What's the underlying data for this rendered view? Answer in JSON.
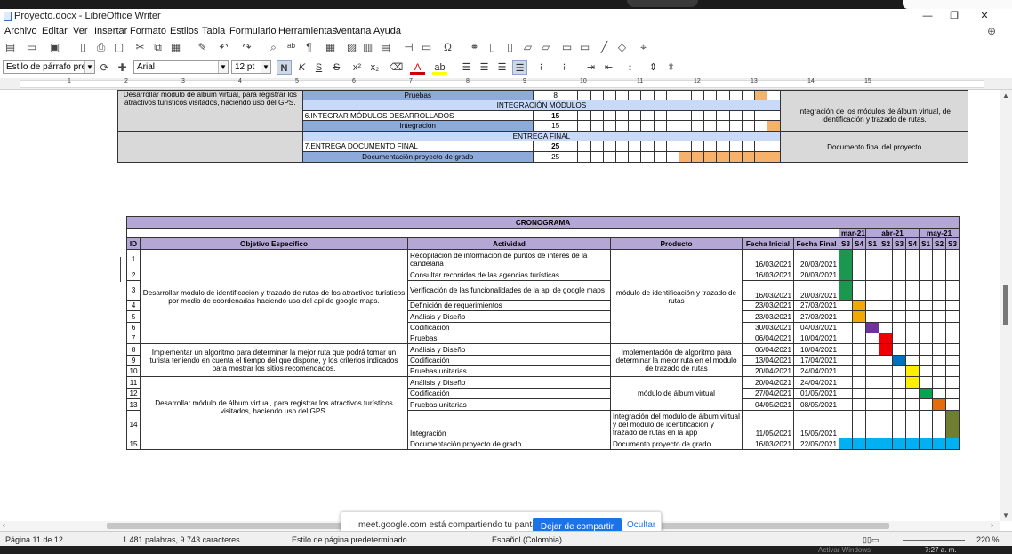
{
  "window": {
    "title": "Proyecto.docx - LibreOffice Writer"
  },
  "menu": [
    "Archivo",
    "Editar",
    "Ver",
    "Insertar",
    "Formato",
    "Estilos",
    "Tabla",
    "Formulario",
    "Herramientas",
    "Ventana",
    "Ayuda"
  ],
  "formatting": {
    "paragraph_style": "Estilo de párrafo predeterminado",
    "font_name": "Arial",
    "font_size": "12 pt",
    "bold": "N",
    "italic": "K",
    "underline": "S",
    "strike": "S",
    "superscript": "x²",
    "subscript": "x₂",
    "font_color": "A",
    "highlight": "ab"
  },
  "ruler": {
    "marks": [
      "1",
      "2",
      "3",
      "4",
      "5",
      "6",
      "7",
      "8",
      "9",
      "10",
      "11",
      "12",
      "13",
      "14",
      "15"
    ]
  },
  "upper_table": {
    "desc": "Desarrollar módulo de álbum virtual, para registrar los atractivos turísticos visitados, haciendo uso del GPS.",
    "rows": [
      {
        "label": "Pruebas",
        "num": "8",
        "kind": "task",
        "fill": "#f6b26b"
      },
      {
        "label": "INTEGRACIÓN MÓDULOS",
        "num": "",
        "kind": "section"
      },
      {
        "label": "6.INTEGRAR MÓDULOS DESARROLLADOS",
        "num": "15",
        "kind": "phase"
      },
      {
        "label": "Integración",
        "num": "15",
        "kind": "task",
        "fill": "#f6b26b"
      },
      {
        "label": "ENTREGA FINAL",
        "num": "",
        "kind": "section"
      },
      {
        "label": "7.ENTREGA DOCUMENTO FINAL",
        "num": "25",
        "kind": "phase"
      },
      {
        "label": "Documentación proyecto de grado",
        "num": "25",
        "kind": "task",
        "fill": "#f6b26b"
      }
    ],
    "product_a": "Integración de los módulos de álbum virtual, de identificación y trazado de rutas.",
    "product_b": "Documento final del proyecto"
  },
  "cronograma": {
    "title": "CRONOGRAMA",
    "months": [
      "mar-21",
      "abr-21",
      "may-21"
    ],
    "weeks": [
      "S3",
      "S4",
      "S1",
      "S2",
      "S3",
      "S4",
      "S1",
      "S2",
      "S3"
    ],
    "headers": {
      "id": "ID",
      "objective": "Objetivo Especifico",
      "activity": "Actividad",
      "product": "Producto",
      "start": "Fecha Inicial",
      "end": "Fecha Final"
    },
    "objectives": [
      "Desarrollar módulo de identificación y trazado de rutas de los atractivos turísticos por medio de coordenadas haciendo uso del api de google maps.",
      "Implementar un algoritmo para determinar la mejor ruta que podrá tomar un turista teniendo en cuenta el tiempo del que dispone, y los criterios indicados para mostrar los sitios recomendados.",
      "Desarrollar módulo de álbum virtual, para registrar los atractivos turísticos visitados, haciendo uso del GPS."
    ],
    "products": [
      "módulo de identificación y trazado de rutas",
      "Implementación de algoritmo para determinar la mejor ruta en el modulo de trazado de rutas",
      "módulo de álbum virtual",
      "Integración del modulo de álbum virtual y del modulo de identificación y trazado de rutas en la app",
      "Documento proyecto de grado"
    ],
    "rows": [
      {
        "id": "1",
        "activity": "Recopilación de información de puntos de interés de la candelaria",
        "start": "16/03/2021",
        "end": "20/03/2021",
        "bar": [
          0,
          0
        ],
        "color": "#1a9850"
      },
      {
        "id": "2",
        "activity": "Consultar recorridos de las agencias turísticas",
        "start": "16/03/2021",
        "end": "20/03/2021",
        "bar": [
          0,
          0
        ],
        "color": "#1a9850"
      },
      {
        "id": "3",
        "activity": "Verificación de las funcionalidades de la api de google maps",
        "start": "16/03/2021",
        "end": "20/03/2021",
        "bar": [
          0,
          0
        ],
        "color": "#1a9850"
      },
      {
        "id": "4",
        "activity": "Definición de requerimientos",
        "start": "23/03/2021",
        "end": "27/03/2021",
        "bar": [
          1,
          1
        ],
        "color": "#f1a800"
      },
      {
        "id": "5",
        "activity": "Análisis y Diseño",
        "start": "23/03/2021",
        "end": "27/03/2021",
        "bar": [
          1,
          1
        ],
        "color": "#f1a800"
      },
      {
        "id": "6",
        "activity": "Codificación",
        "start": "30/03/2021",
        "end": "04/03/2021",
        "bar": [
          2,
          2
        ],
        "color": "#7030a0"
      },
      {
        "id": "7",
        "activity": "Pruebas",
        "start": "06/04/2021",
        "end": "10/04/2021",
        "bar": [
          3,
          3
        ],
        "color": "#ee0000"
      },
      {
        "id": "8",
        "activity": "Análisis y Diseño",
        "start": "06/04/2021",
        "end": "10/04/2021",
        "bar": [
          3,
          3
        ],
        "color": "#ee0000"
      },
      {
        "id": "9",
        "activity": "Codificación",
        "start": "13/04/2021",
        "end": "17/04/2021",
        "bar": [
          4,
          4
        ],
        "color": "#0070c0"
      },
      {
        "id": "10",
        "activity": "Pruebas unitarias",
        "start": "20/04/2021",
        "end": "24/04/2021",
        "bar": [
          5,
          5
        ],
        "color": "#ffee00"
      },
      {
        "id": "11",
        "activity": "Análisis y Diseño",
        "start": "20/04/2021",
        "end": "24/04/2021",
        "bar": [
          5,
          5
        ],
        "color": "#ffee00"
      },
      {
        "id": "12",
        "activity": "Codificación",
        "start": "27/04/2021",
        "end": "01/05/2021",
        "bar": [
          6,
          6
        ],
        "color": "#00a651"
      },
      {
        "id": "13",
        "activity": "Pruebas unitarias",
        "start": "04/05/2021",
        "end": "08/05/2021",
        "bar": [
          7,
          7
        ],
        "color": "#e46c0a"
      },
      {
        "id": "14",
        "activity": "Integración",
        "start": "11/05/2021",
        "end": "15/05/2021",
        "bar": [
          8,
          8
        ],
        "color": "#6e7f32"
      },
      {
        "id": "15",
        "activity": "Documentación proyecto de grado",
        "start": "16/03/2021",
        "end": "22/05/2021",
        "bar": [
          0,
          8
        ],
        "color": "#00b0f0"
      }
    ]
  },
  "share_bar": {
    "message": "meet.google.com está compartiendo tu pantalla.",
    "stop": "Dejar de compartir",
    "hide": "Ocultar"
  },
  "status": {
    "page": "Página 11 de 12",
    "words": "1.481 palabras, 9.743 caracteres",
    "page_style": "Estilo de página predeterminado",
    "language": "Español (Colombia)",
    "zoom": "220 %"
  },
  "taskbar": {
    "watermark": "Activar Windows",
    "time": "7:27 a. m."
  }
}
